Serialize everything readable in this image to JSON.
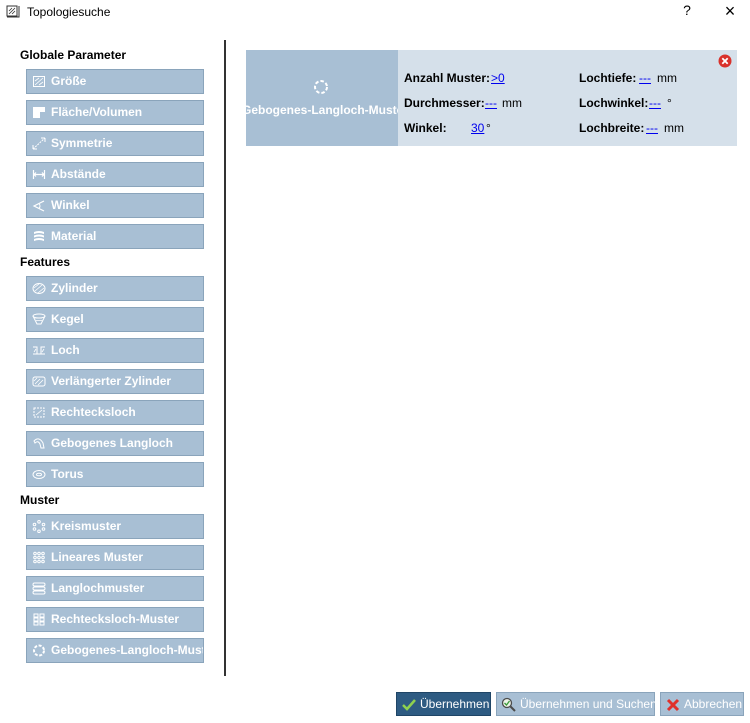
{
  "window": {
    "title": "Topologiesuche",
    "help": "?",
    "close": "×"
  },
  "sidebar": {
    "sections": [
      {
        "title": "Globale Parameter",
        "items": [
          "Größe",
          "Fläche/Volumen",
          "Symmetrie",
          "Abstände",
          "Winkel",
          "Material"
        ]
      },
      {
        "title": "Features",
        "items": [
          "Zylinder",
          "Kegel",
          "Loch",
          "Verlängerter Zylinder",
          "Rechtecksloch",
          "Gebogenes Langloch",
          "Torus"
        ]
      },
      {
        "title": "Muster",
        "items": [
          "Kreismuster",
          "Lineares Muster",
          "Langlochmuster",
          "Rechtecksloch-Muster",
          "Gebogenes-Langloch-Muster"
        ]
      }
    ]
  },
  "card": {
    "name": "Gebogenes-Langloch-Muster",
    "fields": {
      "anzahl_muster": {
        "label": "Anzahl Muster:",
        "value": ">0",
        "unit": ""
      },
      "durchmesser": {
        "label": "Durchmesser:",
        "value": "---",
        "unit": "mm"
      },
      "winkel": {
        "label": "Winkel:",
        "value": "30",
        "unit": "°"
      },
      "lochtiefe": {
        "label": "Lochtiefe:",
        "value": "---",
        "unit": "mm"
      },
      "lochwinkel": {
        "label": "Lochwinkel:",
        "value": "---",
        "unit": "°"
      },
      "lochbreite": {
        "label": "Lochbreite:",
        "value": "---",
        "unit": "mm"
      }
    }
  },
  "footer": {
    "apply": "Übernehmen",
    "apply_search": "Übernehmen und Suchen",
    "cancel": "Abbrechen"
  },
  "colors": {
    "button_bg": "#a8bfd4",
    "card_bg": "#d5e0ea",
    "primary": "#2e5b82",
    "link": "#0000ee",
    "close_red": "#d9312b"
  }
}
